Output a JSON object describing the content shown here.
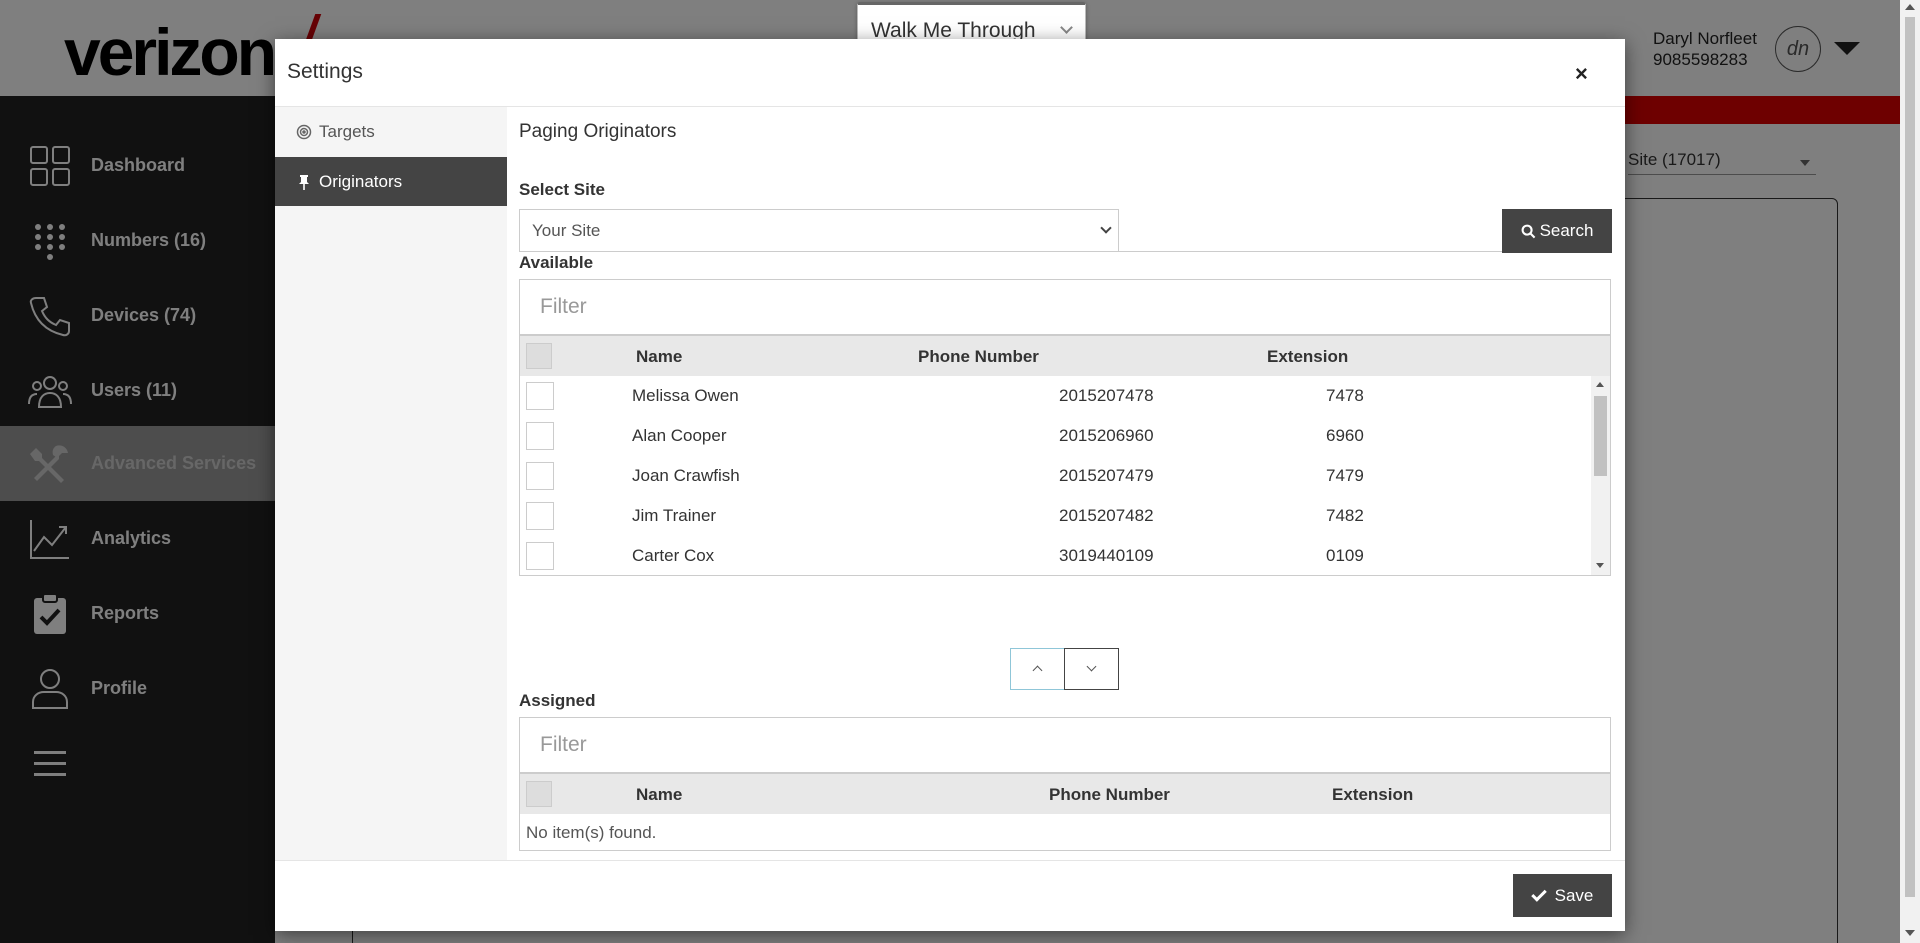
{
  "app": {
    "brand": "verizon",
    "user_name": "Daryl Norfleet",
    "user_phone": "9085598283",
    "avatar_initials": "dn",
    "accent_color": "#cd040b"
  },
  "sidebar": {
    "items": [
      {
        "label": "Dashboard",
        "icon": "dashboard-grid-icon"
      },
      {
        "label": "Numbers (16)",
        "icon": "keypad-icon"
      },
      {
        "label": "Devices (74)",
        "icon": "phone-handset-icon"
      },
      {
        "label": "Users (11)",
        "icon": "users-group-icon"
      },
      {
        "label": "Advanced Services",
        "icon": "tools-icon",
        "active": true
      },
      {
        "label": "Analytics",
        "icon": "line-chart-icon"
      },
      {
        "label": "Reports",
        "icon": "clipboard-check-icon"
      },
      {
        "label": "Profile",
        "icon": "person-icon"
      },
      {
        "label": "",
        "icon": "hamburger-menu-icon"
      }
    ]
  },
  "background": {
    "site_selector": "Site (17017)"
  },
  "walkme": {
    "label": "Walk Me Through"
  },
  "modal": {
    "title": "Settings",
    "close_label": "×",
    "nav": [
      {
        "label": "Targets",
        "icon": "target-icon"
      },
      {
        "label": "Originators",
        "icon": "pin-icon",
        "active": true
      }
    ],
    "section_title": "Paging Originators",
    "select_site_label": "Select Site",
    "select_site_value": "Your Site",
    "search_label": "Search",
    "available_label": "Available",
    "available_filter_placeholder": "Filter",
    "columns": {
      "name": "Name",
      "phone": "Phone Number",
      "extension": "Extension"
    },
    "available_rows": [
      {
        "name": "Melissa Owen",
        "phone": "2015207478",
        "extension": "7478"
      },
      {
        "name": "Alan Cooper",
        "phone": "2015206960",
        "extension": "6960"
      },
      {
        "name": "Joan Crawfish",
        "phone": "2015207479",
        "extension": "7479"
      },
      {
        "name": "Jim Trainer",
        "phone": "2015207482",
        "extension": "7482"
      },
      {
        "name": "Carter Cox",
        "phone": "3019440109",
        "extension": "0109"
      }
    ],
    "assigned_label": "Assigned",
    "assigned_filter_placeholder": "Filter",
    "assigned_empty": "No item(s) found.",
    "save_label": "Save"
  }
}
